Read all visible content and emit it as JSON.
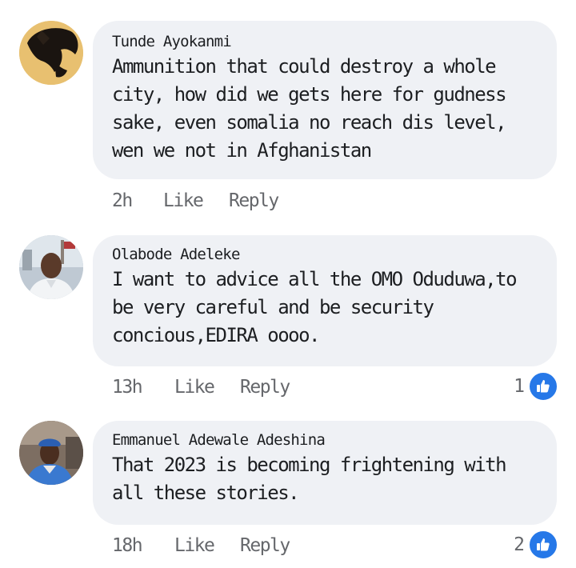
{
  "comments": [
    {
      "author": "Tunde Ayokanmi",
      "text": "Ammunition that could destroy a whole city, how did we gets here for gudness sake, even somalia no reach dis level, wen we not in Afghanistan",
      "time": "2h",
      "like_label": "Like",
      "reply_label": "Reply",
      "reactions": null
    },
    {
      "author": "Olabode Adeleke",
      "text": "I want to advice all the OMO Oduduwa,to be very careful and be security concious,EDIRA oooo.",
      "time": "13h",
      "like_label": "Like",
      "reply_label": "Reply",
      "reactions": "1"
    },
    {
      "author": "Emmanuel Adewale Adeshina",
      "text": "That 2023 is becoming frightening with all these stories.",
      "time": "18h",
      "like_label": "Like",
      "reply_label": "Reply",
      "reactions": "2"
    }
  ],
  "colors": {
    "bubble": "#eff1f5",
    "meta": "#65676b",
    "like_badge": "#2678e8"
  },
  "icons": {
    "reaction": "thumbs-up-icon"
  }
}
